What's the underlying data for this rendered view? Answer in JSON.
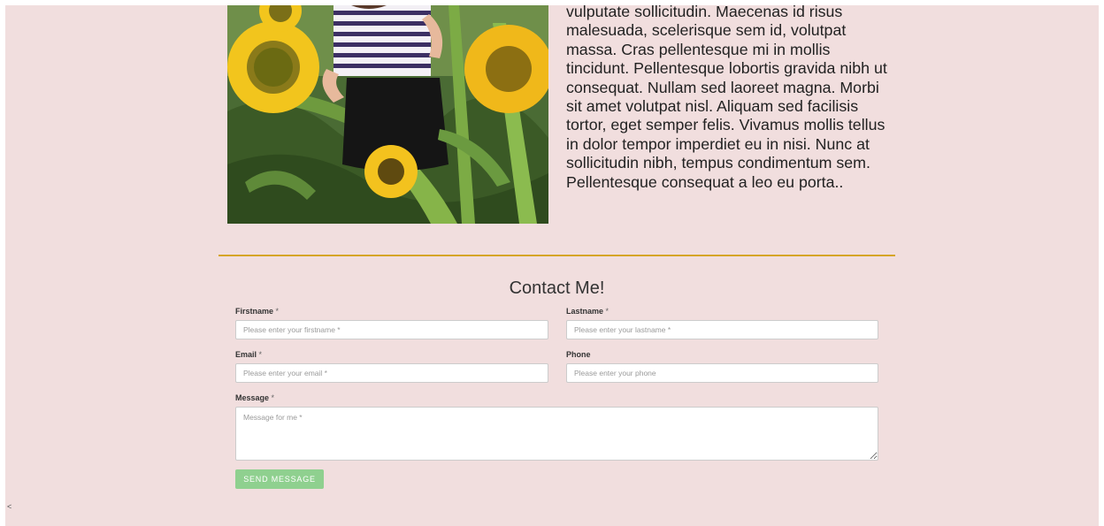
{
  "about": {
    "photo_alt": "",
    "bio_text": "vulputate sollicitudin. Maecenas id risus malesuada, scelerisque sem id, volutpat massa. Cras pellentesque mi in mollis tincidunt. Pellentesque lobortis gravida nibh ut consequat. Nullam sed laoreet magna. Morbi sit amet volutpat nisl. Aliquam sed facilisis tortor, eget semper felis. Vivamus mollis tellus in dolor tempor imperdiet eu in nisi. Nunc at sollicitudin nibh, tempus condimentum sem. Pellentesque consequat a leo eu porta.."
  },
  "contact": {
    "title": "Contact Me!",
    "firstname": {
      "label": "Firstname",
      "required_mark": "*",
      "placeholder": "Please enter your firstname *",
      "value": ""
    },
    "lastname": {
      "label": "Lastname",
      "required_mark": "*",
      "placeholder": "Please enter your lastname *",
      "value": ""
    },
    "email": {
      "label": "Email",
      "required_mark": "*",
      "placeholder": "Please enter your email *",
      "value": ""
    },
    "phone": {
      "label": "Phone",
      "required_mark": "",
      "placeholder": "Please enter your phone",
      "value": ""
    },
    "message": {
      "label": "Message",
      "required_mark": "*",
      "placeholder": "Message for me *",
      "value": ""
    },
    "send_label": "SEND MESSAGE"
  },
  "corner_glyph": "<",
  "colors": {
    "page_background": "#f1dede",
    "divider": "#d6a527",
    "send_button": "#8fd08f",
    "input_border": "#cccccc"
  }
}
